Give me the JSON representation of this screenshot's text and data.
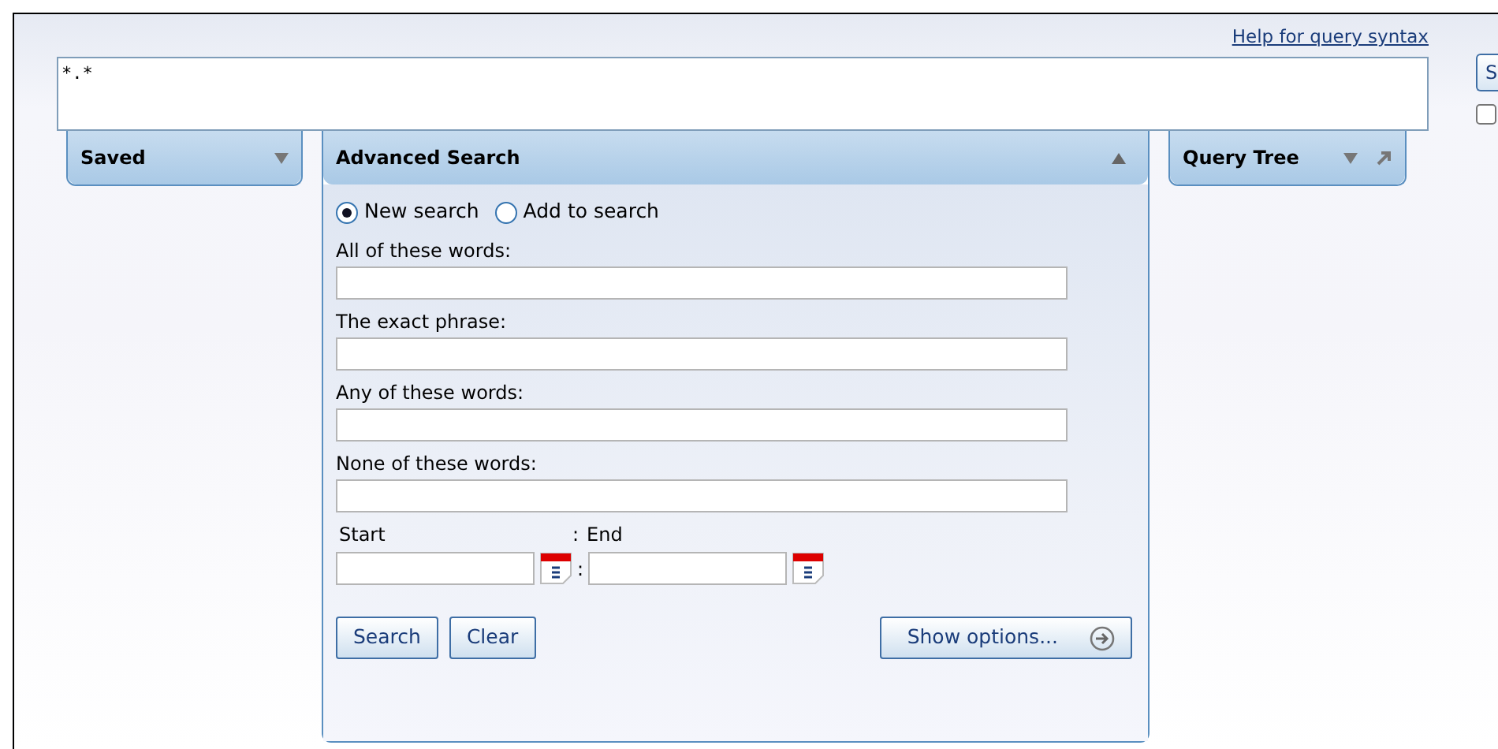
{
  "help_link": "Help for query syntax",
  "query": {
    "value": "*.*"
  },
  "side_button": "S",
  "side_checkbox": {
    "checked": false
  },
  "panels": [
    {
      "title": "Saved",
      "expanded": false,
      "pinnable": false
    },
    {
      "title": "Advanced Search",
      "expanded": true,
      "pinnable": false
    },
    {
      "title": "Query Tree",
      "expanded": false,
      "pinnable": true
    }
  ],
  "advanced_search": {
    "modes": [
      {
        "label": "New search",
        "selected": true
      },
      {
        "label": "Add to search",
        "selected": false
      }
    ],
    "fields": [
      {
        "label": "All of these words:"
      },
      {
        "label": "The exact phrase:"
      },
      {
        "label": "Any of these words:"
      },
      {
        "label": "None of these words:"
      }
    ],
    "range": {
      "start_label": "Start",
      "separator_top": ":",
      "end_label": "End",
      "separator": ":"
    },
    "buttons": [
      "Search",
      "Clear"
    ],
    "options_button": "Show options..."
  }
}
